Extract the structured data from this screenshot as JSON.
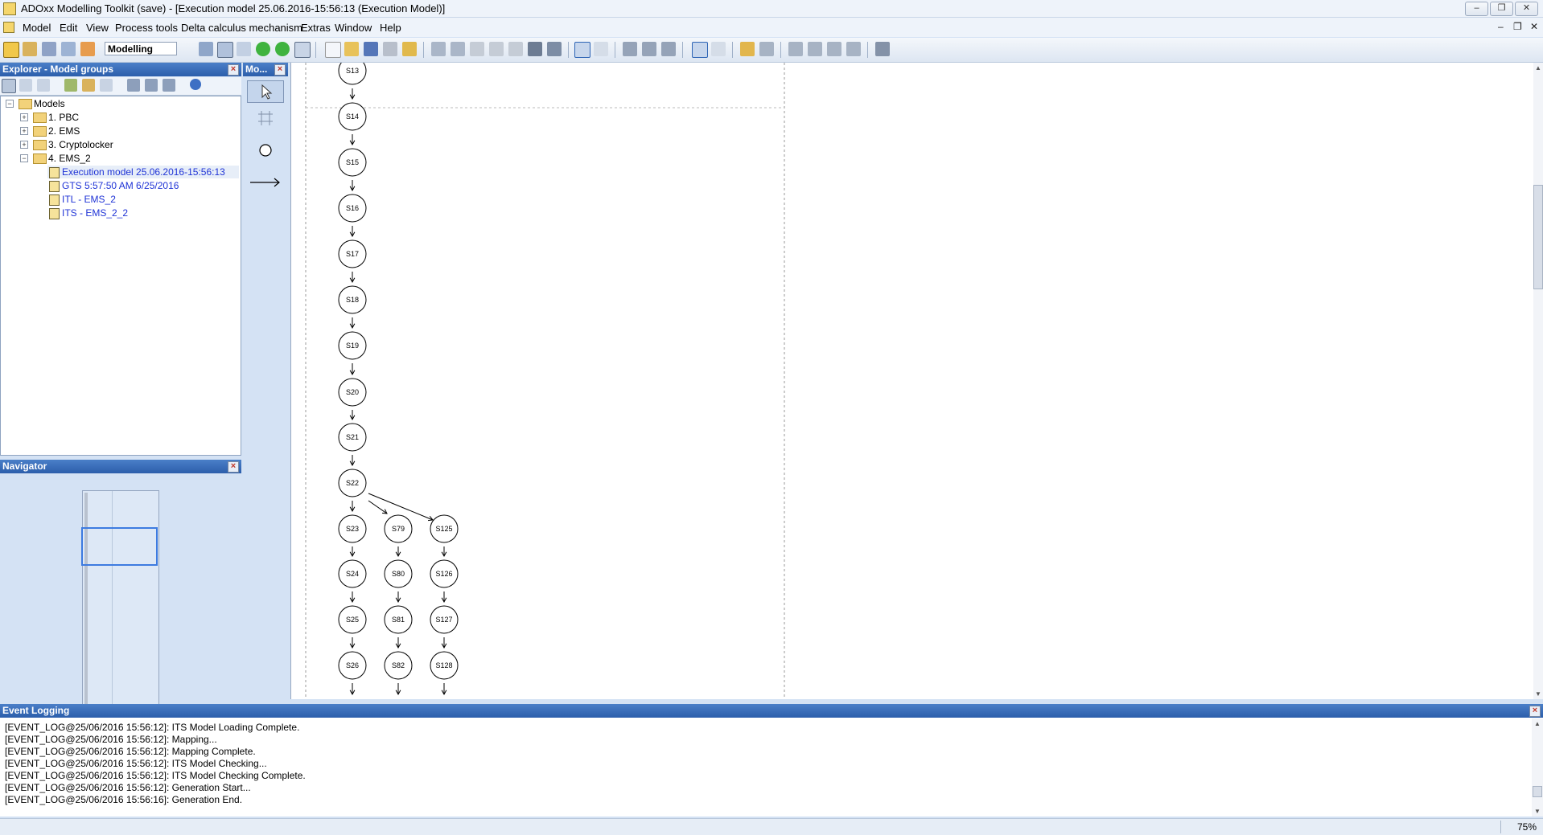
{
  "window": {
    "title": "ADOxx Modelling Toolkit (save) - [Execution model 25.06.2016-15:56:13 (Execution Model)]",
    "controls": {
      "minimize": "–",
      "restore": "❐",
      "close": "✕"
    }
  },
  "menu": {
    "items": [
      "Model",
      "Edit",
      "View",
      "Process tools",
      "Delta calculus mechanism",
      "Extras",
      "Window",
      "Help"
    ],
    "mdi_controls": {
      "minimize": "–",
      "restore": "❐",
      "close": "✕"
    }
  },
  "toolbar": {
    "mode_label": "Modelling"
  },
  "explorer": {
    "title": "Explorer - Model groups",
    "tree": {
      "root": "Models",
      "groups": [
        "1. PBC",
        "2. EMS",
        "3. Cryptolocker",
        "4. EMS_2"
      ],
      "models": [
        "Execution model 25.06.2016-15:56:13",
        "GTS 5:57:50 AM 6/25/2016",
        "ITL - EMS_2",
        "ITS - EMS_2_2"
      ]
    }
  },
  "navigator": {
    "title": "Navigator"
  },
  "modelling_bar": {
    "title": "Mo..."
  },
  "diagram": {
    "main_chain": [
      "S13",
      "S14",
      "S15",
      "S16",
      "S17",
      "S18",
      "S19",
      "S20",
      "S21",
      "S22",
      "S23",
      "S24",
      "S25",
      "S26"
    ],
    "branch_1": [
      "S79",
      "S80",
      "S81",
      "S82"
    ],
    "branch_2": [
      "S125",
      "S126",
      "S127",
      "S128"
    ]
  },
  "event_log": {
    "title": "Event Logging",
    "lines": [
      "[EVENT_LOG@25/06/2016 15:56:12]: ITS Model Loading Complete.",
      "[EVENT_LOG@25/06/2016 15:56:12]: Mapping...",
      "[EVENT_LOG@25/06/2016 15:56:12]: Mapping Complete.",
      "[EVENT_LOG@25/06/2016 15:56:12]: ITS Model Checking...",
      "[EVENT_LOG@25/06/2016 15:56:12]: ITS Model Checking Complete.",
      "[EVENT_LOG@25/06/2016 15:56:12]: Generation Start...",
      "[EVENT_LOG@25/06/2016 15:56:16]: Generation End."
    ]
  },
  "status": {
    "zoom": "75%"
  },
  "colors": {
    "panel_header": "#2c5eab",
    "link": "#1f33d6",
    "accent": "#3d7be0"
  }
}
